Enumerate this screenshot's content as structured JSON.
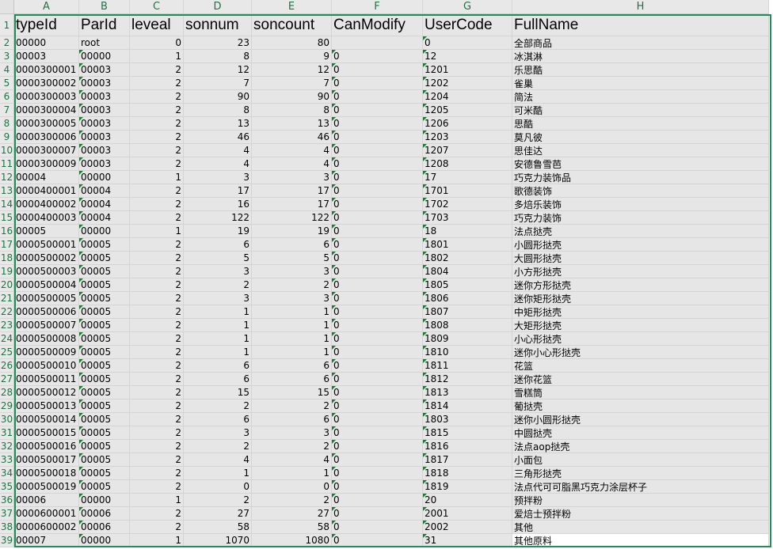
{
  "columns": [
    "A",
    "B",
    "C",
    "D",
    "E",
    "F",
    "G",
    "H"
  ],
  "headers": [
    "typeId",
    "ParId",
    "leveal",
    "sonnum",
    "soncount",
    "CanModify",
    "UserCode",
    "FullName"
  ],
  "rows": [
    [
      "00000",
      "root",
      "0",
      "23",
      "80",
      "",
      "0",
      "全部商品"
    ],
    [
      "00003",
      "00000",
      "1",
      "8",
      "9",
      "0",
      "12",
      "冰淇淋"
    ],
    [
      "0000300001",
      "00003",
      "2",
      "12",
      "12",
      "0",
      "1201",
      "乐思酷"
    ],
    [
      "0000300002",
      "00003",
      "2",
      "7",
      "7",
      "0",
      "1202",
      "雀巢"
    ],
    [
      "0000300003",
      "00003",
      "2",
      "90",
      "90",
      "0",
      "1204",
      "简法"
    ],
    [
      "0000300004",
      "00003",
      "2",
      "8",
      "8",
      "0",
      "1205",
      "可米酷"
    ],
    [
      "0000300005",
      "00003",
      "2",
      "13",
      "13",
      "0",
      "1206",
      "思酷"
    ],
    [
      "0000300006",
      "00003",
      "2",
      "46",
      "46",
      "0",
      "1203",
      "莫凡彼"
    ],
    [
      "0000300007",
      "00003",
      "2",
      "4",
      "4",
      "0",
      "1207",
      "思佳达"
    ],
    [
      "0000300009",
      "00003",
      "2",
      "4",
      "4",
      "0",
      "1208",
      "安德鲁雪芭"
    ],
    [
      "00004",
      "00000",
      "1",
      "3",
      "3",
      "0",
      "17",
      "巧克力装饰品"
    ],
    [
      "0000400001",
      "00004",
      "2",
      "17",
      "17",
      "0",
      "1701",
      "歌德装饰"
    ],
    [
      "0000400002",
      "00004",
      "2",
      "16",
      "17",
      "0",
      "1702",
      "多焙乐装饰"
    ],
    [
      "0000400003",
      "00004",
      "2",
      "122",
      "122",
      "0",
      "1703",
      "巧克力装饰"
    ],
    [
      "00005",
      "00000",
      "1",
      "19",
      "19",
      "0",
      "18",
      "法点挞壳"
    ],
    [
      "0000500001",
      "00005",
      "2",
      "6",
      "6",
      "0",
      "1801",
      "小圆形挞壳"
    ],
    [
      "0000500002",
      "00005",
      "2",
      "5",
      "5",
      "0",
      "1802",
      "大圆形挞壳"
    ],
    [
      "0000500003",
      "00005",
      "2",
      "3",
      "3",
      "0",
      "1804",
      "小方形挞壳"
    ],
    [
      "0000500004",
      "00005",
      "2",
      "2",
      "2",
      "0",
      "1805",
      "迷你方形挞壳"
    ],
    [
      "0000500005",
      "00005",
      "2",
      "3",
      "3",
      "0",
      "1806",
      "迷你矩形挞壳"
    ],
    [
      "0000500006",
      "00005",
      "2",
      "1",
      "1",
      "0",
      "1807",
      "中矩形挞壳"
    ],
    [
      "0000500007",
      "00005",
      "2",
      "1",
      "1",
      "0",
      "1808",
      "大矩形挞壳"
    ],
    [
      "0000500008",
      "00005",
      "2",
      "1",
      "1",
      "0",
      "1809",
      "小心形挞壳"
    ],
    [
      "0000500009",
      "00005",
      "2",
      "1",
      "1",
      "0",
      "1810",
      "迷你小心形挞壳"
    ],
    [
      "0000500010",
      "00005",
      "2",
      "6",
      "6",
      "0",
      "1811",
      "花篮"
    ],
    [
      "0000500011",
      "00005",
      "2",
      "6",
      "6",
      "0",
      "1812",
      "迷你花篮"
    ],
    [
      "0000500012",
      "00005",
      "2",
      "15",
      "15",
      "0",
      "1813",
      "雪糕筒"
    ],
    [
      "0000500013",
      "00005",
      "2",
      "2",
      "2",
      "0",
      "1814",
      "葡挞壳"
    ],
    [
      "0000500014",
      "00005",
      "2",
      "6",
      "6",
      "0",
      "1803",
      "迷你小圆形挞壳"
    ],
    [
      "0000500015",
      "00005",
      "2",
      "3",
      "3",
      "0",
      "1815",
      "中圆挞壳"
    ],
    [
      "0000500016",
      "00005",
      "2",
      "2",
      "2",
      "0",
      "1816",
      "法点aop挞壳"
    ],
    [
      "0000500017",
      "00005",
      "2",
      "4",
      "4",
      "0",
      "1817",
      "小面包"
    ],
    [
      "0000500018",
      "00005",
      "2",
      "1",
      "1",
      "0",
      "1818",
      "三角形挞壳"
    ],
    [
      "0000500019",
      "00005",
      "2",
      "0",
      "0",
      "0",
      "1819",
      "法点代可可脂黑巧克力涂层杯子"
    ],
    [
      "00006",
      "00000",
      "1",
      "2",
      "2",
      "0",
      "20",
      "预拌粉"
    ],
    [
      "0000600001",
      "00006",
      "2",
      "27",
      "27",
      "0",
      "2001",
      "爱焙士预拌粉"
    ],
    [
      "0000600002",
      "00006",
      "2",
      "58",
      "58",
      "0",
      "2002",
      "其他"
    ],
    [
      "00007",
      "00000",
      "1",
      "1070",
      "1080",
      "0",
      "31",
      "其他原料"
    ]
  ]
}
